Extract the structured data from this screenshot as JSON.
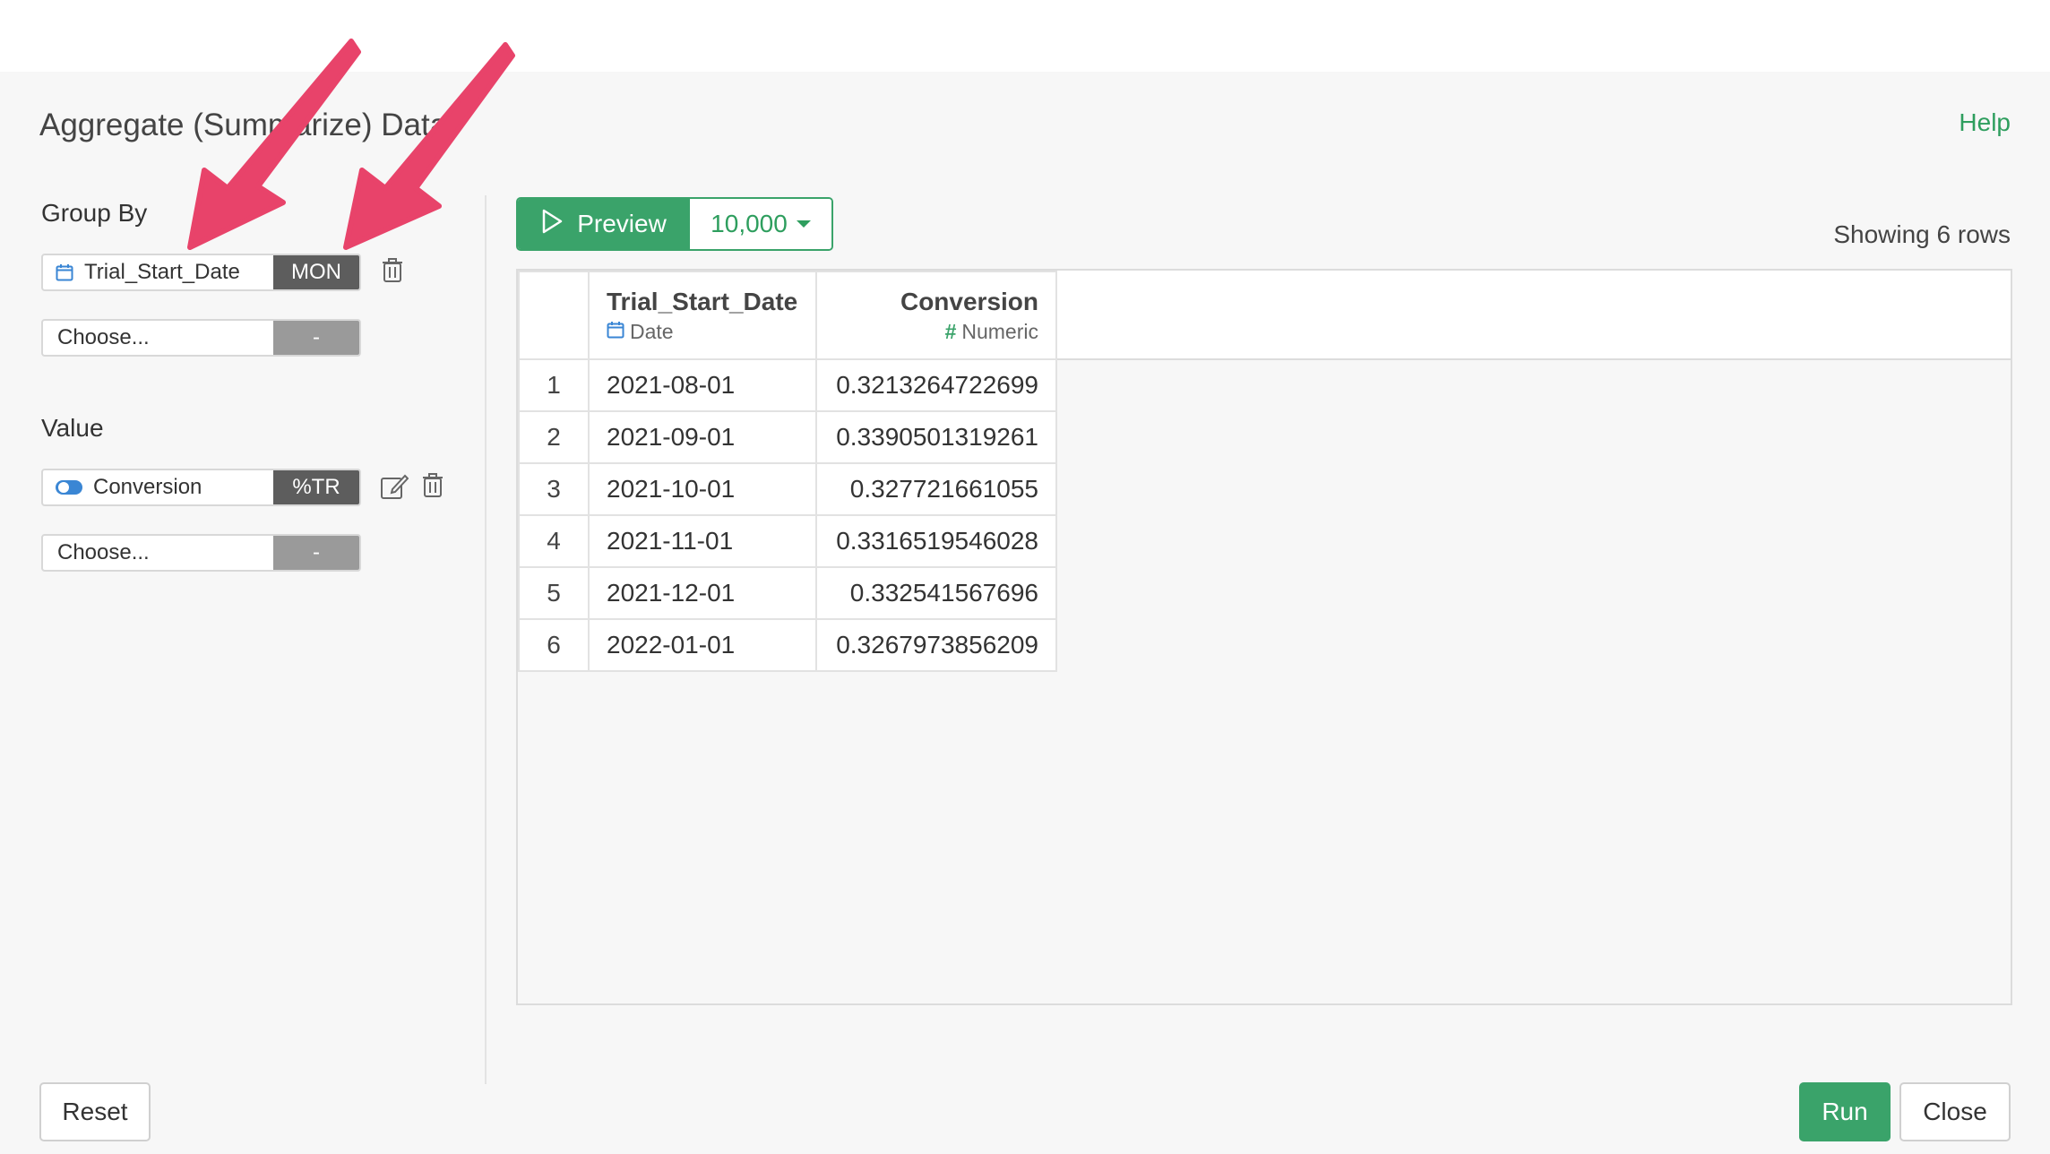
{
  "dialog": {
    "title": "Aggregate (Summarize) Data",
    "help_label": "Help"
  },
  "group_by": {
    "label": "Group By",
    "fields": [
      {
        "name": "Trial_Start_Date",
        "icon": "calendar-icon",
        "tag": "MON"
      },
      {
        "name": "Choose...",
        "icon": "",
        "tag": "-"
      }
    ]
  },
  "value": {
    "label": "Value",
    "fields": [
      {
        "name": "Conversion",
        "icon": "toggle-icon",
        "tag": "%TR"
      },
      {
        "name": "Choose...",
        "icon": "",
        "tag": "-"
      }
    ]
  },
  "preview": {
    "button_label": "Preview",
    "row_limit": "10,000",
    "showing": "Showing 6 rows"
  },
  "table": {
    "columns": [
      {
        "name": "Trial_Start_Date",
        "type": "Date",
        "type_icon": "calendar-icon"
      },
      {
        "name": "Conversion",
        "type": "Numeric",
        "type_icon": "hash-icon"
      }
    ],
    "rows": [
      {
        "idx": "1",
        "date": "2021-08-01",
        "conv": "0.3213264722699"
      },
      {
        "idx": "2",
        "date": "2021-09-01",
        "conv": "0.3390501319261"
      },
      {
        "idx": "3",
        "date": "2021-10-01",
        "conv": "0.327721661055"
      },
      {
        "idx": "4",
        "date": "2021-11-01",
        "conv": "0.3316519546028"
      },
      {
        "idx": "5",
        "date": "2021-12-01",
        "conv": "0.332541567696"
      },
      {
        "idx": "6",
        "date": "2022-01-01",
        "conv": "0.3267973856209"
      }
    ]
  },
  "footer": {
    "reset_label": "Reset",
    "run_label": "Run",
    "close_label": "Close"
  },
  "colors": {
    "accent": "#3aa36a",
    "annotation_arrow": "#e8436a",
    "tag_dark": "#5d5d5d",
    "tag_empty": "#9a9a9a"
  }
}
